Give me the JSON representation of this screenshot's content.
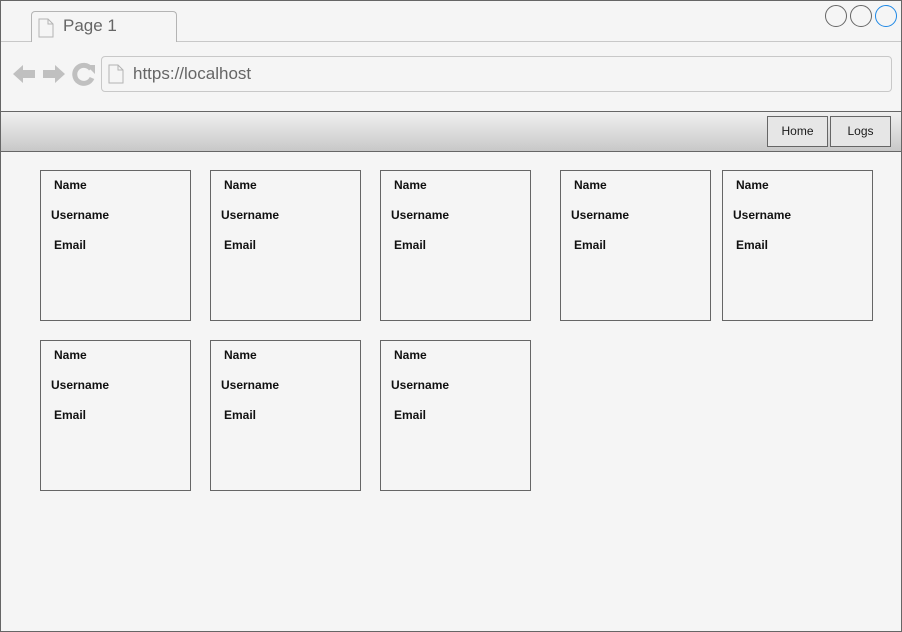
{
  "browser": {
    "tab_title": "Page 1",
    "url": "https://localhost",
    "window_buttons": [
      "minimize",
      "maximize",
      "close"
    ]
  },
  "colors": {
    "background": "#f5f5f5",
    "border": "#666666",
    "accent": "#1e88e5",
    "icon_gray": "#c0c0c0"
  },
  "icons": {
    "tab": "page-icon",
    "back": "arrow-left-icon",
    "forward": "arrow-right-icon",
    "reload": "reload-icon",
    "address": "page-icon"
  },
  "nav": {
    "home": "Home",
    "logs": "Logs"
  },
  "cards": [
    {
      "name": "Name",
      "username": "Username",
      "email": "Email"
    },
    {
      "name": "Name",
      "username": "Username",
      "email": "Email"
    },
    {
      "name": "Name",
      "username": "Username",
      "email": "Email"
    },
    {
      "name": "Name",
      "username": "Username",
      "email": "Email"
    },
    {
      "name": "Name",
      "username": "Username",
      "email": "Email"
    },
    {
      "name": "Name",
      "username": "Username",
      "email": "Email"
    },
    {
      "name": "Name",
      "username": "Username",
      "email": "Email"
    },
    {
      "name": "Name",
      "username": "Username",
      "email": "Email"
    }
  ]
}
